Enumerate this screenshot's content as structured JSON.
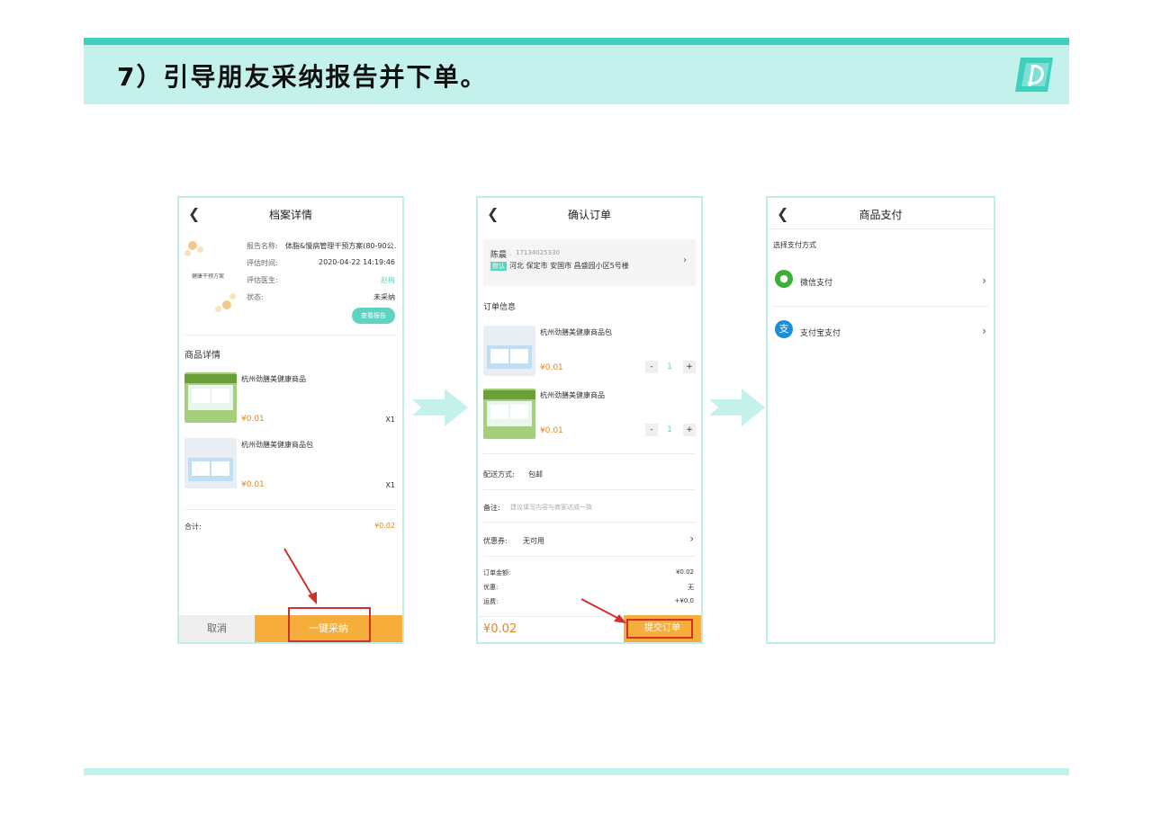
{
  "page": {
    "title": "7）引导朋友采纳报告并下单。"
  },
  "colors": {
    "accent": "#3ecfbd",
    "band": "#c5f1ec",
    "orange": "#f5ae3b",
    "price": "#e8841b",
    "teal_button": "#5fd3c2",
    "highlight": "#d0312d"
  },
  "screen1": {
    "nav_title": "档案详情",
    "back_icon": "chevron-left-icon",
    "cover_caption": "健康干预方案",
    "fields": [
      {
        "label": "报告名称:",
        "value": "体脂&慢病管理干预方案(80-90公..."
      },
      {
        "label": "评估时间:",
        "value": "2020-04-22 14:19:46"
      },
      {
        "label": "评估医生:",
        "value": "赵梅"
      },
      {
        "label": "状态:",
        "value": "未采纳"
      }
    ],
    "view_report_button": "查看报告",
    "section_title": "商品详情",
    "products": [
      {
        "name": "杭州劲膳美健康商品",
        "price": "¥0.01",
        "qty": "X1"
      },
      {
        "name": "杭州劲膳美健康商品包",
        "price": "¥0.01",
        "qty": "X1"
      }
    ],
    "total_label": "合计:",
    "total_value": "¥0.02",
    "cancel_button": "取消",
    "adopt_button": "一键采纳"
  },
  "screen2": {
    "nav_title": "确认订单",
    "back_icon": "chevron-left-icon",
    "address": {
      "name": "陈晨",
      "phone": "17134025330",
      "default_tag": "默认",
      "detail": "河北 保定市 安国市 昌盛园小区5号楼"
    },
    "section_title": "订单信息",
    "products": [
      {
        "name": "杭州劲膳美健康商品包",
        "price": "¥0.01",
        "qty": "1",
        "minus": "-",
        "plus": "+"
      },
      {
        "name": "杭州劲膳美健康商品",
        "price": "¥0.01",
        "qty": "1",
        "minus": "-",
        "plus": "+"
      }
    ],
    "delivery_label": "配送方式:",
    "delivery_value": "包邮",
    "remark_label": "备注:",
    "remark_placeholder": "建议填写内容与商家达成一致",
    "coupon_label": "优惠券:",
    "coupon_value": "无可用",
    "summary": [
      {
        "label": "订单金额:",
        "value": "¥0.02"
      },
      {
        "label": "优惠:",
        "value": "无"
      },
      {
        "label": "运费:",
        "value": "+¥0.0"
      }
    ],
    "total": "¥0.02",
    "submit_button": "提交订单"
  },
  "screen3": {
    "nav_title": "商品支付",
    "back_icon": "chevron-left-icon",
    "section_title": "选择支付方式",
    "methods": [
      {
        "label": "微信支付",
        "icon": "wechat-icon",
        "color": "#3cb034"
      },
      {
        "label": "支付宝支付",
        "icon": "alipay-icon",
        "color": "#1a8fd8"
      }
    ]
  }
}
